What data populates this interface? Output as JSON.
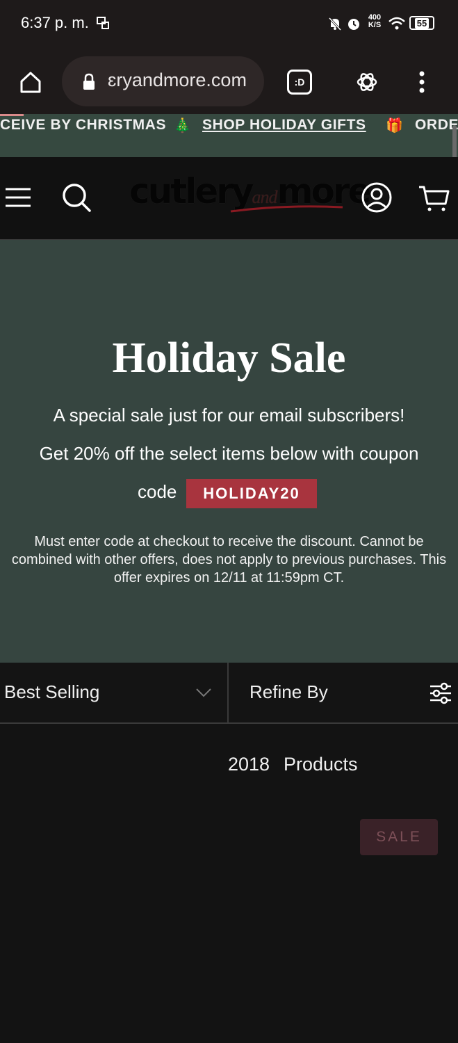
{
  "status_bar": {
    "time": "6:37 p. m.",
    "network_speed_value": "400",
    "network_speed_unit": "K/S",
    "battery": "55"
  },
  "browser": {
    "url": "ɛryandmore.com",
    "tab_count_label": ":D"
  },
  "ticker": {
    "left_text": "CEIVE BY CHRISTMAS",
    "tree_emoji": "🎄",
    "link_text": "SHOP HOLIDAY GIFTS",
    "gift_emoji": "🎁",
    "right_text": "ORDE"
  },
  "header": {
    "logo_word1": "cutlery",
    "logo_word2": "and",
    "logo_word3": "more"
  },
  "hero": {
    "title": "Holiday Sale",
    "line1": "A special sale just for our email subscribers!",
    "line2": "Get 20% off the select items below with coupon",
    "code_label": "code",
    "coupon_code": "HOLIDAY20",
    "fine_print": "Must enter code at checkout to receive the discount. Cannot be combined with other offers, does not apply to previous purchases. This offer expires on 12/11 at 11:59pm CT."
  },
  "toolbar": {
    "sort_label": "Best Selling",
    "refine_label": "Refine By"
  },
  "results": {
    "count": "2018",
    "count_label": "Products",
    "badge": "SALE"
  },
  "colors": {
    "hero_bg": "#364540",
    "ticker_bg": "#364940",
    "coupon_bg": "#a8343e",
    "page_bg": "#131313"
  }
}
